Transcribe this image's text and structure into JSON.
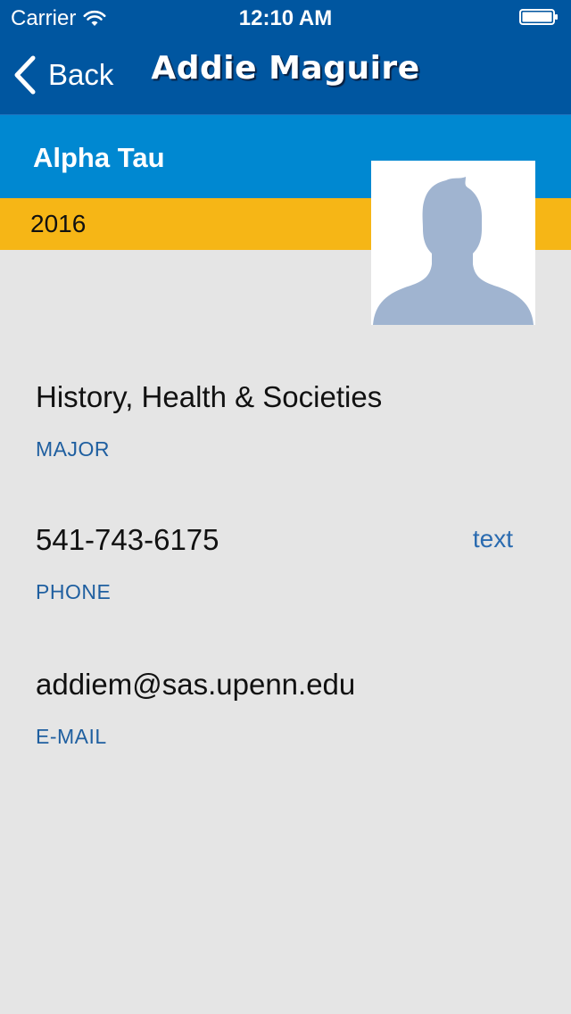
{
  "status_bar": {
    "carrier": "Carrier",
    "time": "12:10 AM"
  },
  "nav": {
    "back_label": "Back",
    "title": "Addie Maguire"
  },
  "profile": {
    "chapter": "Alpha Tau",
    "year": "2016",
    "avatar": "default-silhouette-avatar"
  },
  "details": {
    "major": {
      "value": "History, Health & Societies",
      "label": "MAJOR"
    },
    "phone": {
      "value": "541-743-6175",
      "label": "PHONE",
      "action": "text"
    },
    "email": {
      "value": "addiem@sas.upenn.edu",
      "label": "E-MAIL"
    }
  },
  "colors": {
    "nav_bg": "#0056a0",
    "chapter_bg": "#0088d1",
    "year_bg": "#f6b616",
    "page_bg": "#e5e5e5",
    "label_blue": "#1f5fa0",
    "avatar_silhouette": "#a0b4d0"
  }
}
